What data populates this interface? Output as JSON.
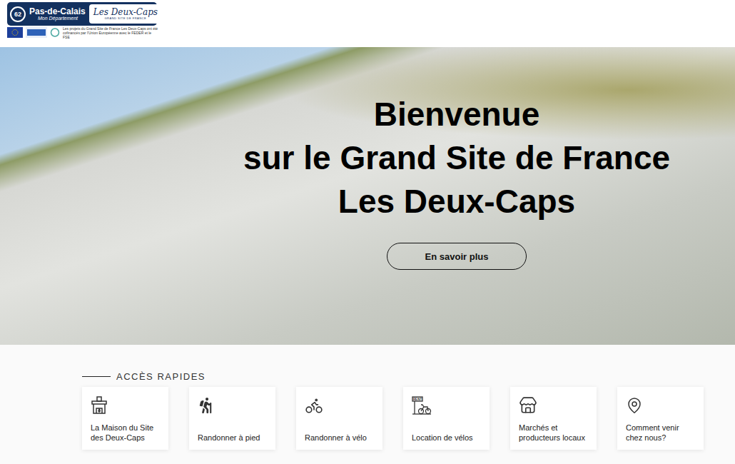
{
  "header": {
    "logo": {
      "number": "62",
      "name": "Pas-de-Calais",
      "subtitle": "Mon Département",
      "brand": "Les Deux-Caps",
      "brand_tagline": "GRAND SITE DE FRANCE"
    },
    "funding_note": "Les projets du Grand Site de France Les Deux-Caps ont été cofinancés par l'Union Européenne avec le FEDER et le FSE"
  },
  "hero": {
    "title_lines": [
      "Bienvenue",
      "sur le Grand Site de France",
      "Les Deux-Caps"
    ],
    "button": "En savoir plus"
  },
  "quick_access": {
    "title": "ACCÈS RAPIDES",
    "items": [
      {
        "label": "La Maison du Site des Deux-Caps",
        "kind": "house"
      },
      {
        "label": "Randonner à pied",
        "kind": "hiking"
      },
      {
        "label": "Randonner à vélo",
        "kind": "bike"
      },
      {
        "label": "Location de vélos",
        "kind": "rental",
        "sign": "RENT"
      },
      {
        "label": "Marchés et producteurs locaux",
        "kind": "market"
      },
      {
        "label": "Comment venir chez nous?",
        "kind": "location"
      }
    ]
  }
}
